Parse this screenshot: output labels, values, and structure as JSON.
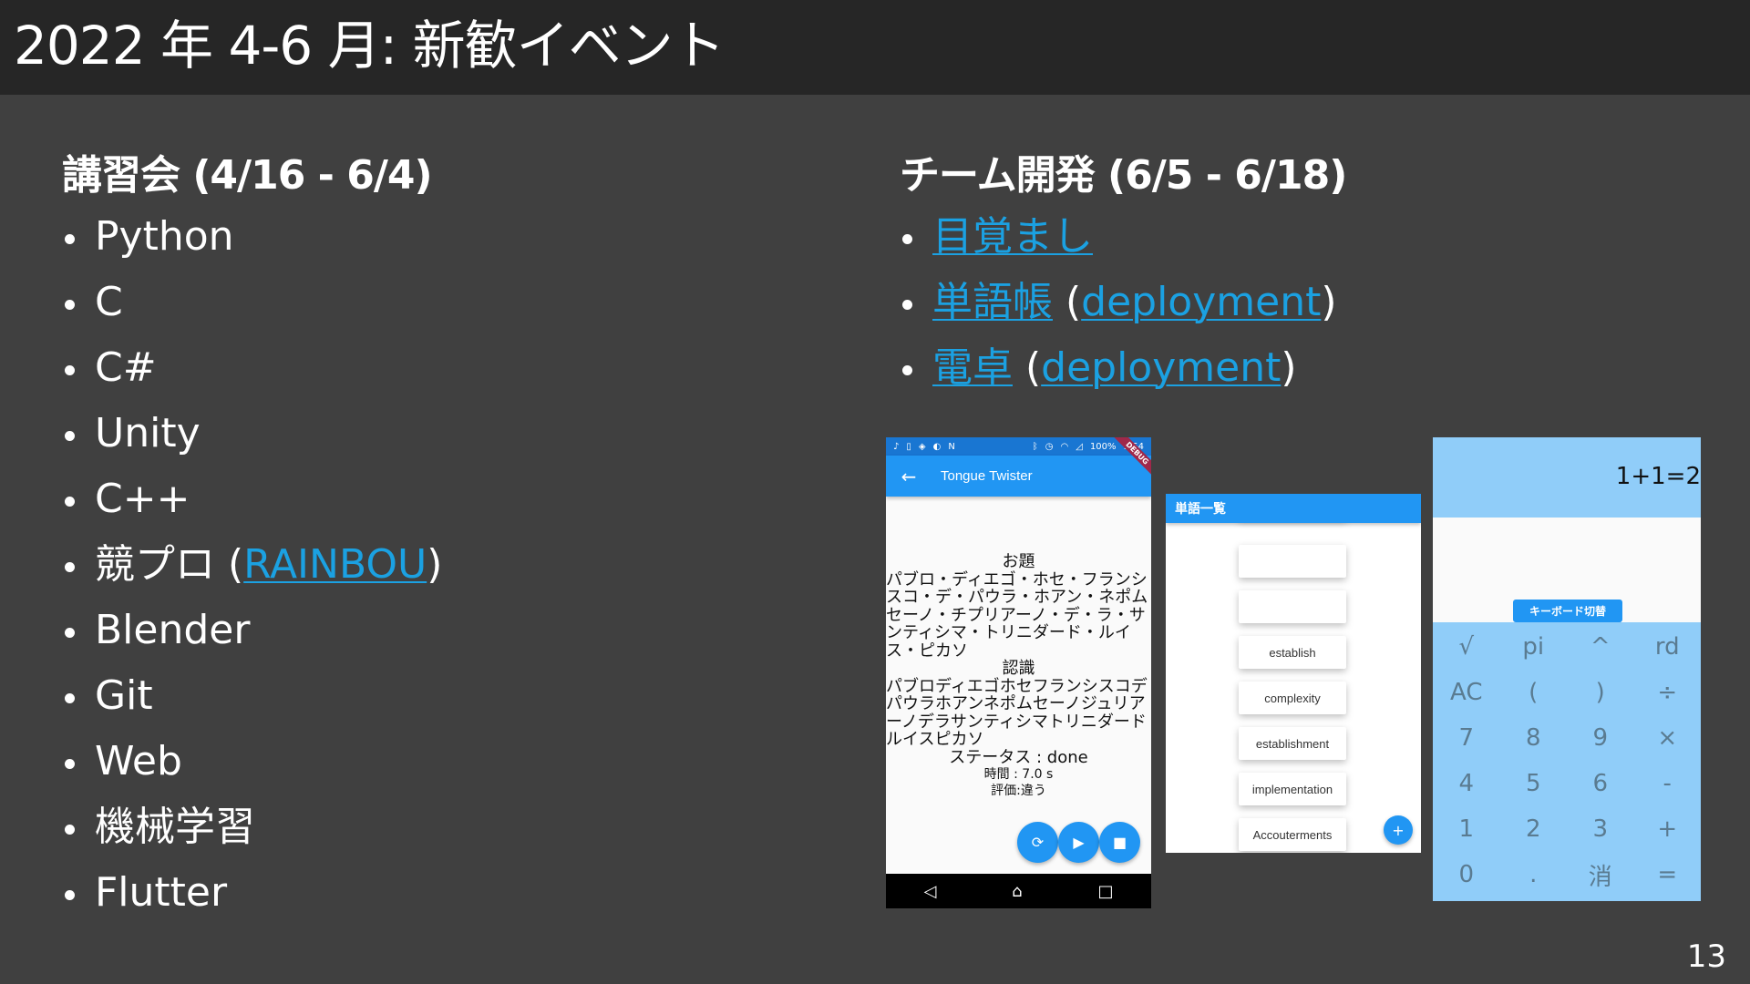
{
  "slide": {
    "title": "2022 年 4-6 月: 新歓イベント",
    "page_number": "13",
    "colors": {
      "header_bg": "#262626",
      "body_bg": "#404040",
      "link": "#1ba1e2"
    }
  },
  "left": {
    "heading": "講習会 (4/16 - 6/4)",
    "items": [
      {
        "text": "Python"
      },
      {
        "text": "C"
      },
      {
        "text": "C#"
      },
      {
        "text": "Unity"
      },
      {
        "text": "C++"
      },
      {
        "text": "競プロ",
        "paren_open": "(",
        "link": "RAINBOU",
        "paren_close": ")"
      },
      {
        "text": "Blender"
      },
      {
        "text": "Git"
      },
      {
        "text": "Web"
      },
      {
        "text": "機械学習"
      },
      {
        "text": "Flutter"
      }
    ]
  },
  "right": {
    "heading": "チーム開発 (6/5 - 6/18)",
    "items": [
      {
        "link": "目覚まし"
      },
      {
        "link": "単語帳",
        "paren_open": " (",
        "sublink": "deployment",
        "paren_close": ")"
      },
      {
        "link": "電卓",
        "paren_open": " (",
        "sublink": "deployment",
        "paren_close": ")"
      }
    ]
  },
  "tongue_twister_app": {
    "status_bar": {
      "battery": "100%",
      "time": "9:54"
    },
    "app_title": "Tongue Twister",
    "debug_banner": "DEBUG",
    "topic_label": "お題",
    "topic_text": "パブロ・ディエゴ・ホセ・フランシスコ・デ・パウラ・ホアン・ネポムセーノ・チプリアーノ・デ・ラ・サンティシマ・トリニダード・ルイス・ピカソ",
    "recognition_label": "認識",
    "recognition_text": "パブロディエゴホセフランシスコデパウラホアンネポムセーノジュリアーノデラサンティシマトリニダードルイスピカソ",
    "status": "ステータス : done",
    "time": "時間 : 7.0 s",
    "evaluation": "評価:違う",
    "fab_icons": [
      "refresh-icon",
      "play-icon",
      "stop-icon"
    ],
    "nav": {
      "back": "◁",
      "home": "⌂",
      "recent": "□"
    }
  },
  "wordlist_app": {
    "app_title": "単語一覧",
    "words": [
      "",
      "",
      "establish",
      "complexity",
      "establishment",
      "implementation",
      "Accouterments"
    ],
    "fab_label": "+"
  },
  "calculator_app": {
    "display": "1+1=2",
    "switch_button": "キーボード切替",
    "keys": [
      "√",
      "pi",
      "^",
      "rd",
      "AC",
      "(",
      ")",
      "÷",
      "7",
      "8",
      "9",
      "×",
      "4",
      "5",
      "6",
      "-",
      "1",
      "2",
      "3",
      "+",
      "0",
      ".",
      "消",
      "="
    ]
  }
}
